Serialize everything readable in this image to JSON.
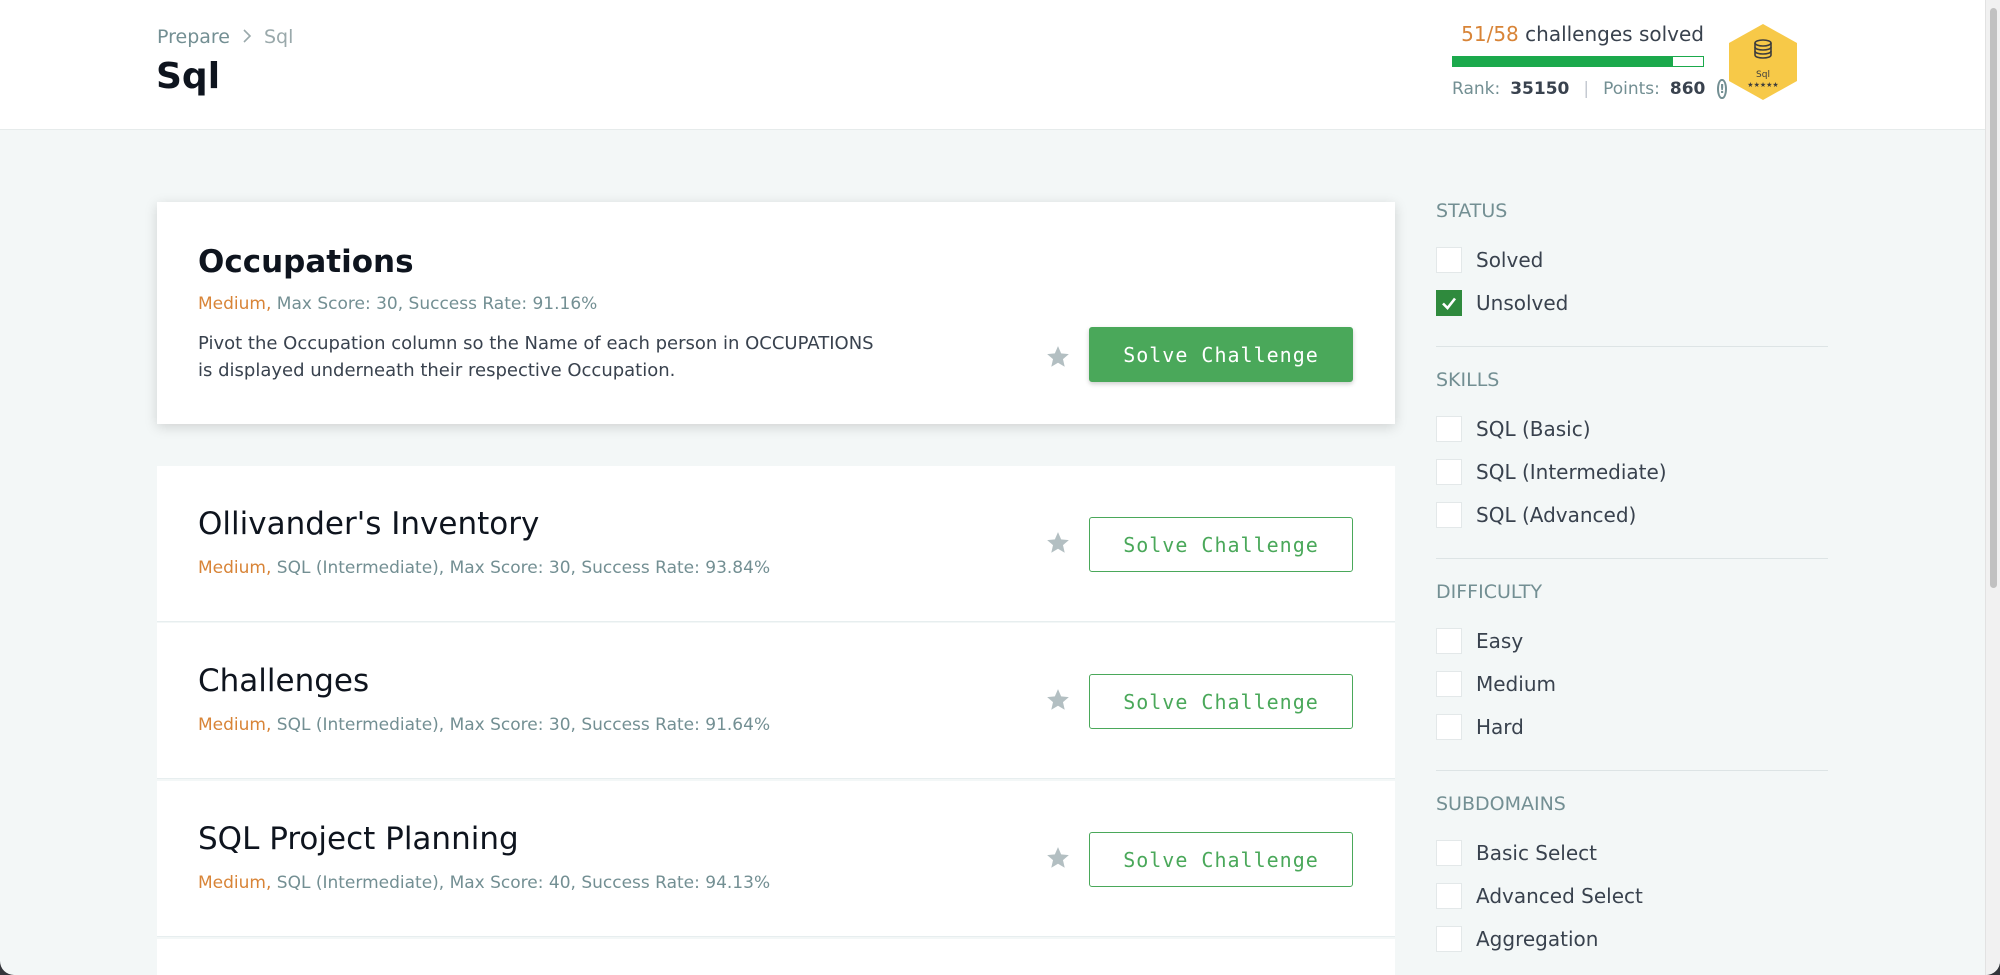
{
  "header": {
    "breadcrumb": [
      "Prepare",
      "Sql"
    ],
    "title": "Sql",
    "progress": {
      "solved_count": "51/58",
      "solved_label": "challenges solved",
      "fraction": 0.879,
      "rank_label": "Rank:",
      "rank_value": "35150",
      "separator": "|",
      "points_label": "Points:",
      "points_value": "860",
      "info_icon": "info-icon"
    },
    "badge": {
      "label": "Sql",
      "stars": "★★★★★",
      "icon": "database-icon"
    }
  },
  "challenges": [
    {
      "title": "Occupations",
      "difficulty": "Medium,",
      "meta": " Max Score: 30, Success Rate: 91.16%",
      "description": "Pivot the Occupation column so the Name of each person in OCCUPATIONS is displayed underneath their respective Occupation.",
      "button": "Solve Challenge"
    },
    {
      "title": "Ollivander's Inventory",
      "difficulty": "Medium,",
      "meta": " SQL (Intermediate), Max Score: 30, Success Rate: 93.84%",
      "button": "Solve Challenge"
    },
    {
      "title": "Challenges",
      "difficulty": "Medium,",
      "meta": " SQL (Intermediate), Max Score: 30, Success Rate: 91.64%",
      "button": "Solve Challenge"
    },
    {
      "title": "SQL Project Planning",
      "difficulty": "Medium,",
      "meta": " SQL (Intermediate), Max Score: 40, Success Rate: 94.13%",
      "button": "Solve Challenge"
    }
  ],
  "filters": {
    "status": {
      "heading": "STATUS",
      "items": [
        {
          "label": "Solved",
          "checked": false
        },
        {
          "label": "Unsolved",
          "checked": true
        }
      ]
    },
    "skills": {
      "heading": "SKILLS",
      "items": [
        {
          "label": "SQL (Basic)",
          "checked": false
        },
        {
          "label": "SQL (Intermediate)",
          "checked": false
        },
        {
          "label": "SQL (Advanced)",
          "checked": false
        }
      ]
    },
    "difficulty": {
      "heading": "DIFFICULTY",
      "items": [
        {
          "label": "Easy",
          "checked": false
        },
        {
          "label": "Medium",
          "checked": false
        },
        {
          "label": "Hard",
          "checked": false
        }
      ]
    },
    "subdomains": {
      "heading": "SUBDOMAINS",
      "items": [
        {
          "label": "Basic Select",
          "checked": false
        },
        {
          "label": "Advanced Select",
          "checked": false
        },
        {
          "label": "Aggregation",
          "checked": false
        }
      ]
    }
  },
  "colors": {
    "accent_green": "#4aa85a",
    "progress_green": "#1ba94c",
    "difficulty_orange": "#d88437",
    "badge_gold": "#f7c948"
  }
}
